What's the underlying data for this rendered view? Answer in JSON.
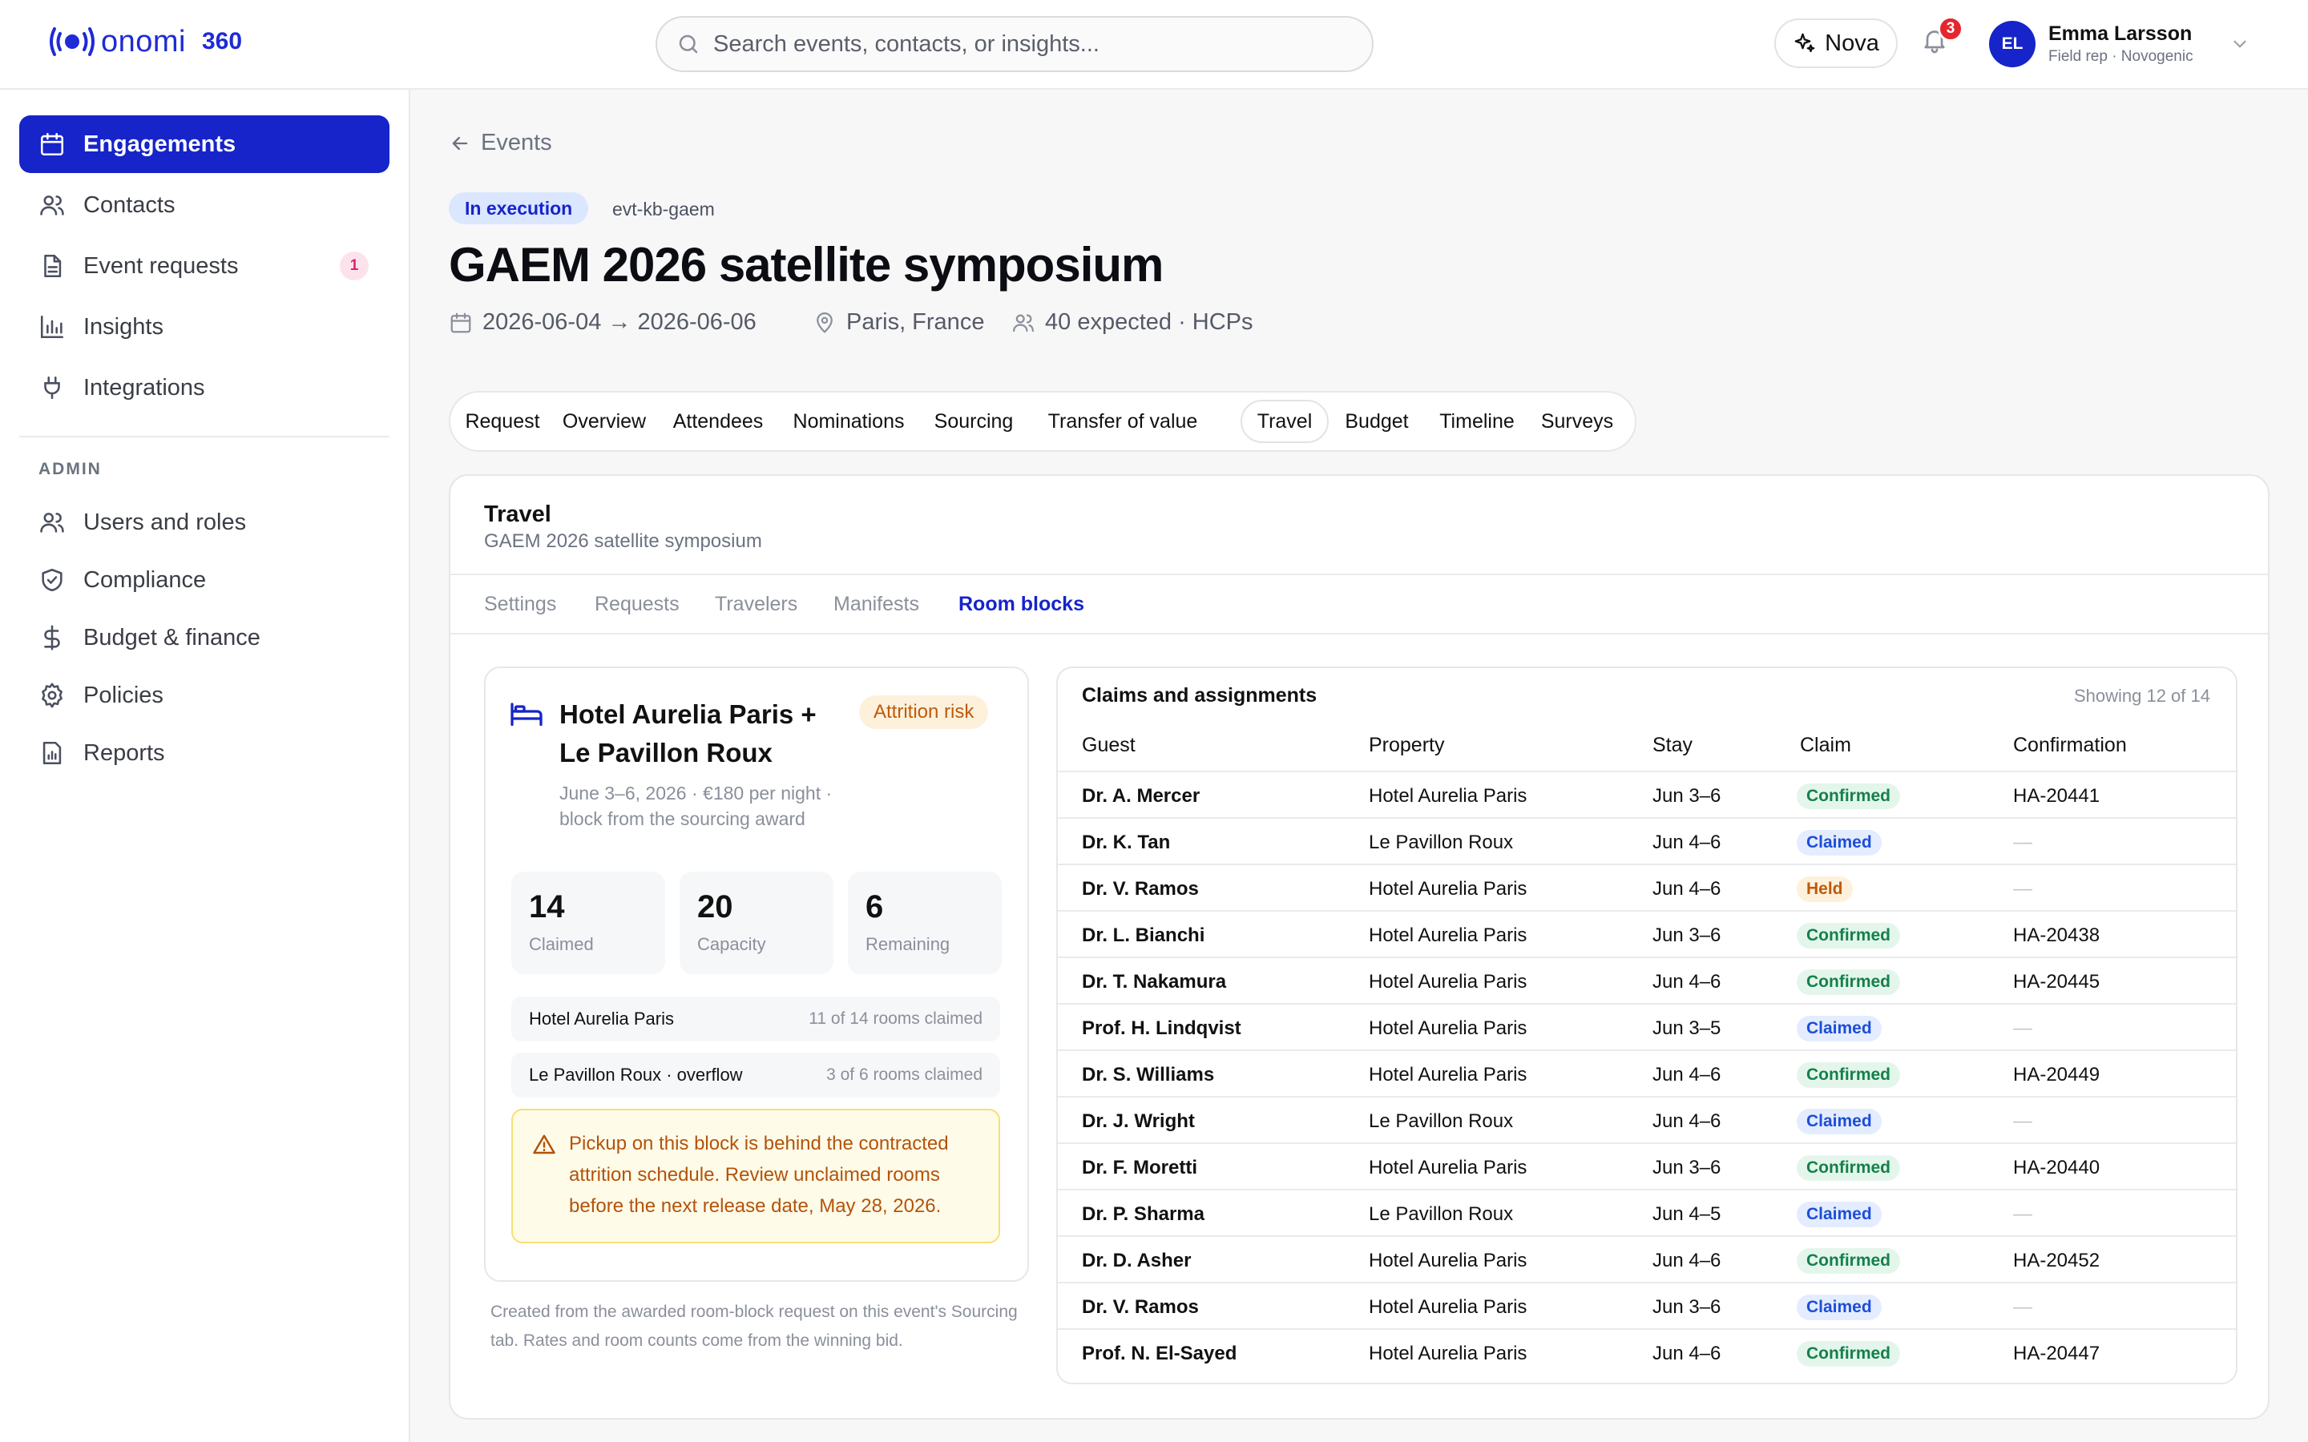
{
  "header": {
    "brand": "onomi",
    "brand_suffix": "360",
    "search_placeholder": "Search events, contacts, or insights...",
    "assistant_label": "Nova",
    "notification_count": "3",
    "user": {
      "initials": "EL",
      "name": "Emma Larsson",
      "role": "Field rep · Novogenic"
    }
  },
  "sidebar": {
    "items": [
      {
        "label": "Engagements",
        "icon": "calendar-icon",
        "active": true
      },
      {
        "label": "Contacts",
        "icon": "users-icon"
      },
      {
        "label": "Event requests",
        "icon": "document-icon",
        "count": "1"
      },
      {
        "label": "Insights",
        "icon": "bar-chart-icon"
      },
      {
        "label": "Integrations",
        "icon": "plug-icon"
      }
    ],
    "admin_label": "ADMIN",
    "admin_items": [
      {
        "label": "Users and roles",
        "icon": "users-icon"
      },
      {
        "label": "Compliance",
        "icon": "shield-icon"
      },
      {
        "label": "Budget & finance",
        "icon": "dollar-icon"
      },
      {
        "label": "Policies",
        "icon": "gear-icon"
      },
      {
        "label": "Reports",
        "icon": "report-icon"
      }
    ]
  },
  "event": {
    "back_label": "Events",
    "status": "In execution",
    "id": "evt-kb-gaem",
    "title": "GAEM 2026 satellite symposium",
    "dates": "2026-06-04 → 2026-06-06",
    "location": "Paris, France",
    "attendance": "40 expected · HCPs"
  },
  "tabs": [
    "Request",
    "Overview",
    "Attendees",
    "Nominations",
    "Sourcing",
    "Transfer of value",
    "Travel",
    "Budget",
    "Timeline",
    "Surveys"
  ],
  "active_tab": "Travel",
  "travel": {
    "title": "Travel",
    "subtitle": "GAEM 2026 satellite symposium",
    "subtabs": [
      "Settings",
      "Requests",
      "Travelers",
      "Manifests",
      "Room blocks"
    ],
    "active_subtab": "Room blocks"
  },
  "room_block": {
    "hotel_name": "Hotel Aurelia Paris + Le Pavillon Roux",
    "risk_label": "Attrition risk",
    "description": "June 3–6, 2026 · €180 per night · block from the sourcing award",
    "stats": [
      {
        "value": "14",
        "label": "Claimed"
      },
      {
        "value": "20",
        "label": "Capacity"
      },
      {
        "value": "6",
        "label": "Remaining"
      }
    ],
    "properties": [
      {
        "name": "Hotel Aurelia Paris",
        "claimed": "11 of 14 rooms claimed"
      },
      {
        "name": "Le Pavillon Roux · overflow",
        "claimed": "3 of 6 rooms claimed"
      }
    ],
    "warning": "Pickup on this block is behind the contracted attrition schedule. Review unclaimed rooms before the next release date, May 28, 2026.",
    "footnote": "Created from the awarded room-block request on this event's Sourcing tab. Rates and room counts come from the winning bid."
  },
  "claims": {
    "title": "Claims and assignments",
    "count_label": "Showing 12 of 14",
    "columns": [
      "Guest",
      "Property",
      "Stay",
      "Claim",
      "Confirmation"
    ],
    "rows": [
      {
        "guest": "Dr. A. Mercer",
        "property": "Hotel Aurelia Paris",
        "stay": "Jun 3–6",
        "claim": "Confirmed",
        "confirmation": "HA-20441"
      },
      {
        "guest": "Dr. K. Tan",
        "property": "Le Pavillon Roux",
        "stay": "Jun 4–6",
        "claim": "Claimed",
        "confirmation": "—"
      },
      {
        "guest": "Dr. V. Ramos",
        "property": "Hotel Aurelia Paris",
        "stay": "Jun 4–6",
        "claim": "Held",
        "confirmation": "—"
      },
      {
        "guest": "Dr. L. Bianchi",
        "property": "Hotel Aurelia Paris",
        "stay": "Jun 3–6",
        "claim": "Confirmed",
        "confirmation": "HA-20438"
      },
      {
        "guest": "Dr. T. Nakamura",
        "property": "Hotel Aurelia Paris",
        "stay": "Jun 4–6",
        "claim": "Confirmed",
        "confirmation": "HA-20445"
      },
      {
        "guest": "Prof. H. Lindqvist",
        "property": "Hotel Aurelia Paris",
        "stay": "Jun 3–5",
        "claim": "Claimed",
        "confirmation": "—"
      },
      {
        "guest": "Dr. S. Williams",
        "property": "Hotel Aurelia Paris",
        "stay": "Jun 4–6",
        "claim": "Confirmed",
        "confirmation": "HA-20449"
      },
      {
        "guest": "Dr. J. Wright",
        "property": "Le Pavillon Roux",
        "stay": "Jun 4–6",
        "claim": "Claimed",
        "confirmation": "—"
      },
      {
        "guest": "Dr. F. Moretti",
        "property": "Hotel Aurelia Paris",
        "stay": "Jun 3–6",
        "claim": "Confirmed",
        "confirmation": "HA-20440"
      },
      {
        "guest": "Dr. P. Sharma",
        "property": "Le Pavillon Roux",
        "stay": "Jun 4–5",
        "claim": "Claimed",
        "confirmation": "—"
      },
      {
        "guest": "Dr. D. Asher",
        "property": "Hotel Aurelia Paris",
        "stay": "Jun 4–6",
        "claim": "Confirmed",
        "confirmation": "HA-20452"
      },
      {
        "guest": "Dr. V. Ramos",
        "property": "Hotel Aurelia Paris",
        "stay": "Jun 3–6",
        "claim": "Claimed",
        "confirmation": "—"
      },
      {
        "guest": "Prof. N. El-Sayed",
        "property": "Hotel Aurelia Paris",
        "stay": "Jun 4–6",
        "claim": "Confirmed",
        "confirmation": "HA-20447"
      }
    ]
  },
  "colors": {
    "accent": "#1624c9",
    "confirmed_text": "#14804a",
    "claimed_text": "#1d4ed8",
    "held_text": "#c05a0a",
    "warning_text": "#b4530b"
  }
}
